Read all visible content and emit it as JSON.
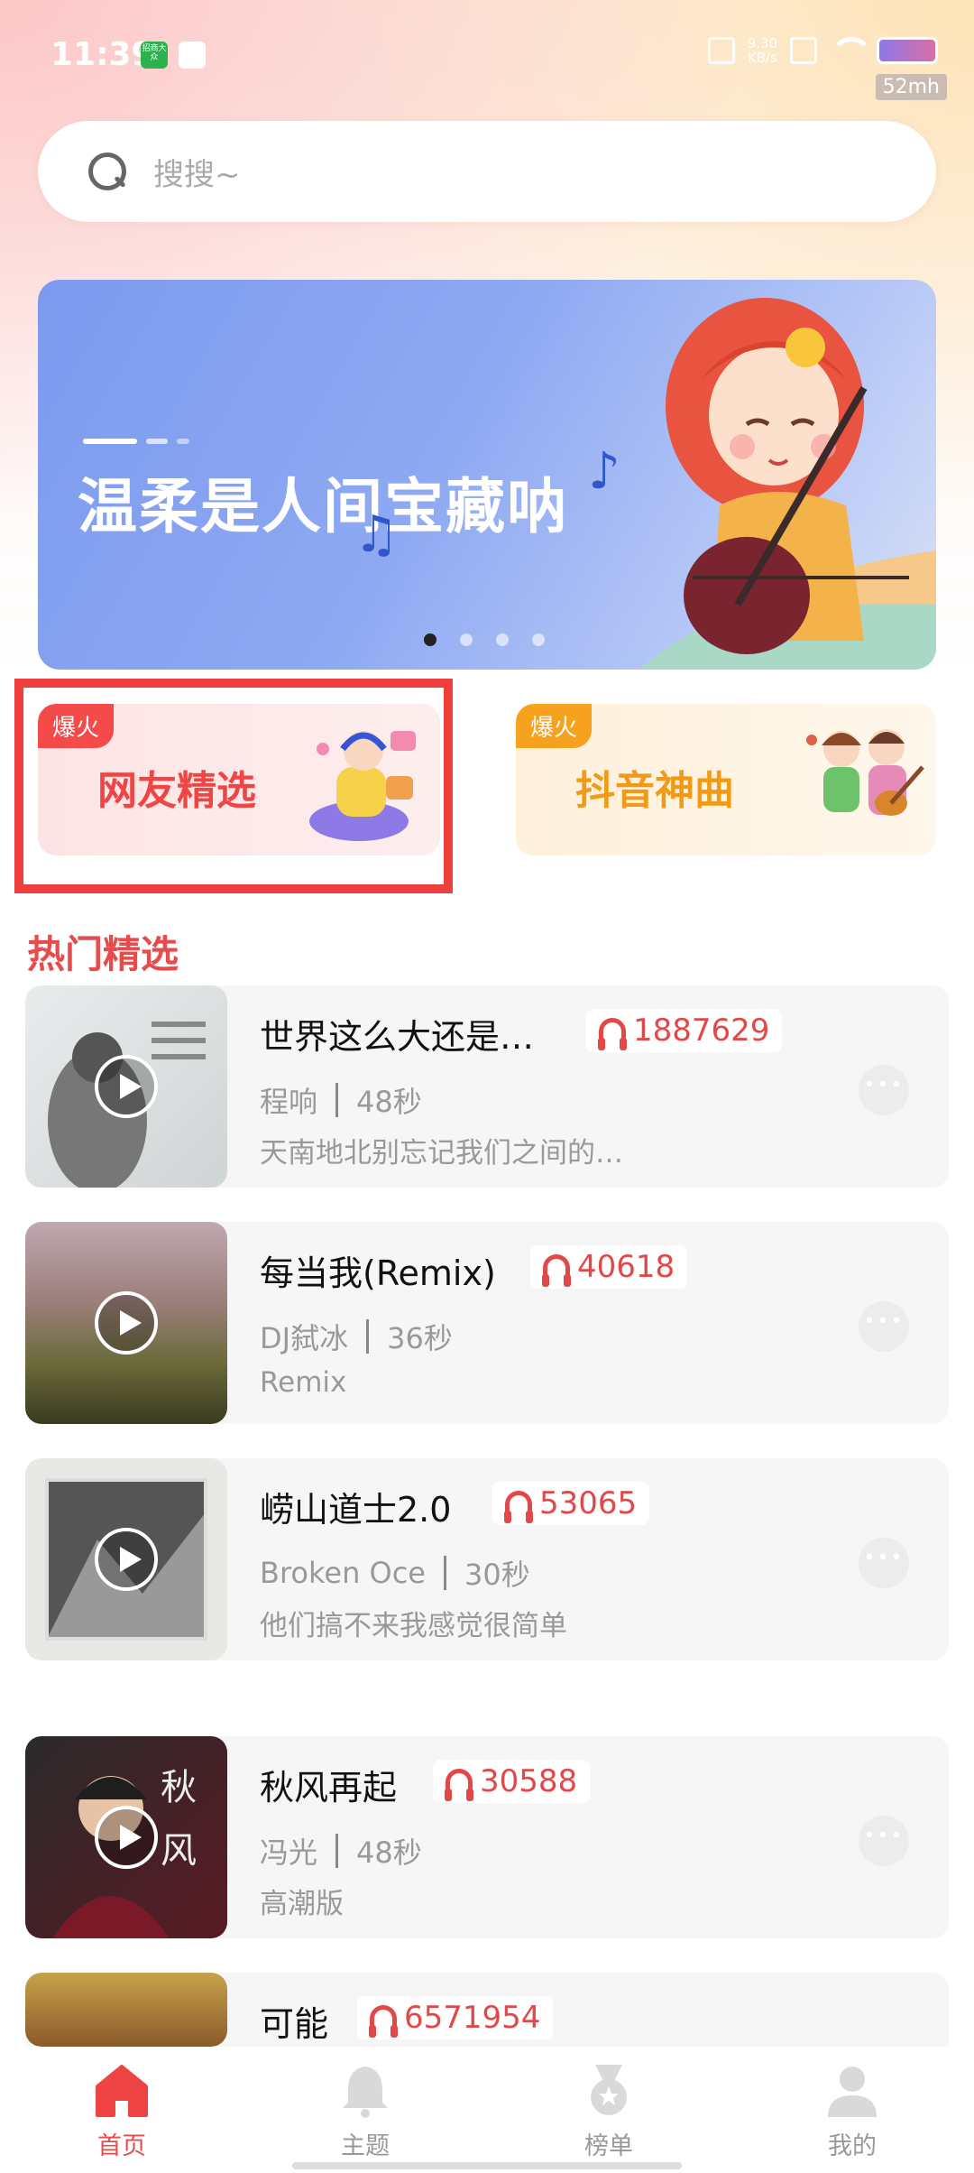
{
  "status_bar": {
    "time": "11:39",
    "app_icon_text": "招商大众",
    "speed_value": "9.30",
    "speed_unit": "KB/s",
    "memory": "52mh"
  },
  "search": {
    "placeholder": "搜搜~"
  },
  "banner": {
    "title": "温柔是人间宝藏呐",
    "dot_count": 4,
    "active_dot": 1
  },
  "categories": [
    {
      "badge": "爆火",
      "title": "网友精选"
    },
    {
      "badge": "爆火",
      "title": "抖音神曲"
    }
  ],
  "section": {
    "title": "热门精选"
  },
  "songs": [
    {
      "title": "世界这么大还是…",
      "plays": "1887629",
      "artist": "程响",
      "duration": "48秒",
      "desc": "天南地北别忘记我们之间的…"
    },
    {
      "title": "每当我(Remix)",
      "plays": "40618",
      "artist": "DJ弑冰",
      "duration": "36秒",
      "desc": "Remix"
    },
    {
      "title": "崂山道士2.0",
      "plays": "53065",
      "artist": "Broken Oce",
      "duration": "30秒",
      "desc": "他们搞不来我感觉很简单"
    },
    {
      "title": "秋风再起",
      "plays": "30588",
      "artist": "冯光",
      "duration": "48秒",
      "desc": "高潮版"
    },
    {
      "title": "可能",
      "plays": "6571954",
      "artist": "",
      "duration": "",
      "desc": ""
    }
  ],
  "tabs": [
    {
      "label": "首页",
      "icon": "home-icon",
      "active": true
    },
    {
      "label": "主题",
      "icon": "bell-icon",
      "active": false
    },
    {
      "label": "榜单",
      "icon": "medal-icon",
      "active": false
    },
    {
      "label": "我的",
      "icon": "user-icon",
      "active": false
    }
  ],
  "colors": {
    "accent": "#e84b4b",
    "banner_blue": "#7c9aef",
    "badge_orange": "#f7a21e",
    "highlight_border": "#ef3e3e"
  }
}
